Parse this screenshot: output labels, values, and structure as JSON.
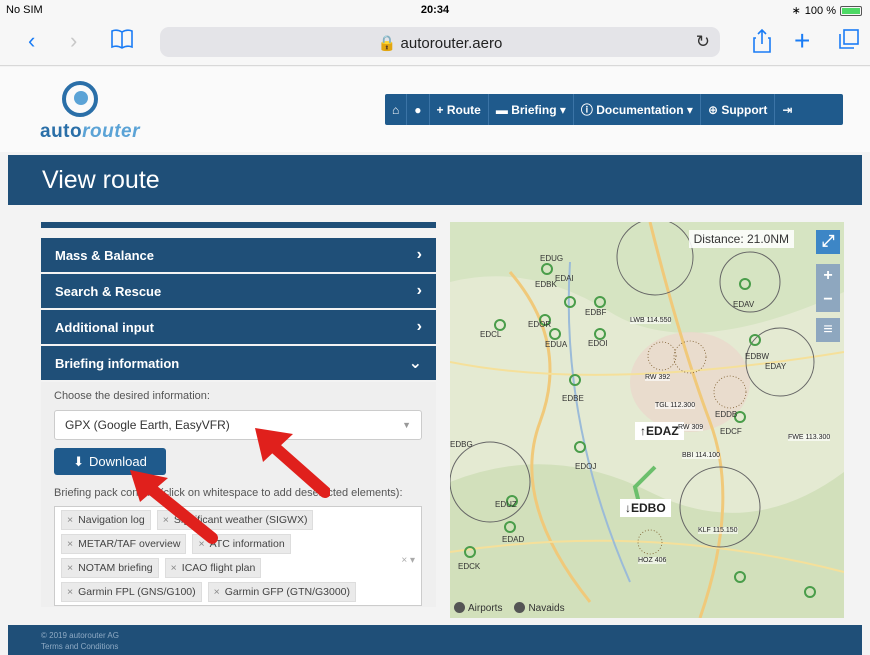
{
  "status": {
    "carrier": "No SIM",
    "time": "20:34",
    "battery": "100 %"
  },
  "browser": {
    "url": "autorouter.aero"
  },
  "logo": {
    "part1": "auto",
    "part2": "router"
  },
  "nav": {
    "route": "Route",
    "briefing": "Briefing",
    "documentation": "Documentation",
    "support": "Support"
  },
  "page": {
    "title": "View route"
  },
  "accordion": {
    "items": [
      {
        "label": "Mass & Balance"
      },
      {
        "label": "Search & Rescue"
      },
      {
        "label": "Additional input"
      },
      {
        "label": "Briefing information"
      }
    ]
  },
  "briefing": {
    "choose_label": "Choose the desired information:",
    "selected": "GPX (Google Earth, EasyVFR)",
    "download_label": "Download",
    "help_text": "Briefing pack content (click on whitespace to add deselected elements):",
    "tags": [
      "Navigation log",
      "Significant weather (SIGWX)",
      "METAR/TAF overview",
      "ATC information",
      "NOTAM briefing",
      "ICAO flight plan",
      "Garmin FPL (GNS/G100)",
      "Garmin GFP (GTN/G3000)"
    ]
  },
  "map": {
    "distance": "Distance: 21.0NM",
    "label_edaz": "↑EDAZ",
    "label_edbo": "↓EDBO",
    "layer_airports": "Airports",
    "layer_navaids": "Navaids",
    "places": [
      "EDUG",
      "EDBK",
      "EDAI",
      "EDBF",
      "EDAV",
      "EDOR",
      "EDCL",
      "EDUA",
      "EDOI",
      "EDBW",
      "EDAY",
      "EDBE",
      "EDDB",
      "EDCF",
      "EDOJ",
      "EDUZ",
      "EDAD",
      "EDCK",
      "EDBG",
      "EDBO",
      "EDAZ"
    ],
    "navaids": [
      "LWB 114.550",
      "TGL 112.300",
      "RW 392",
      "RW 309",
      "BBI 114.100",
      "KLF 115.150",
      "FWE 113.300",
      "HOZ 406"
    ]
  },
  "footer": {
    "copyright": "© 2019 autorouter AG",
    "terms": "Terms and Conditions"
  }
}
